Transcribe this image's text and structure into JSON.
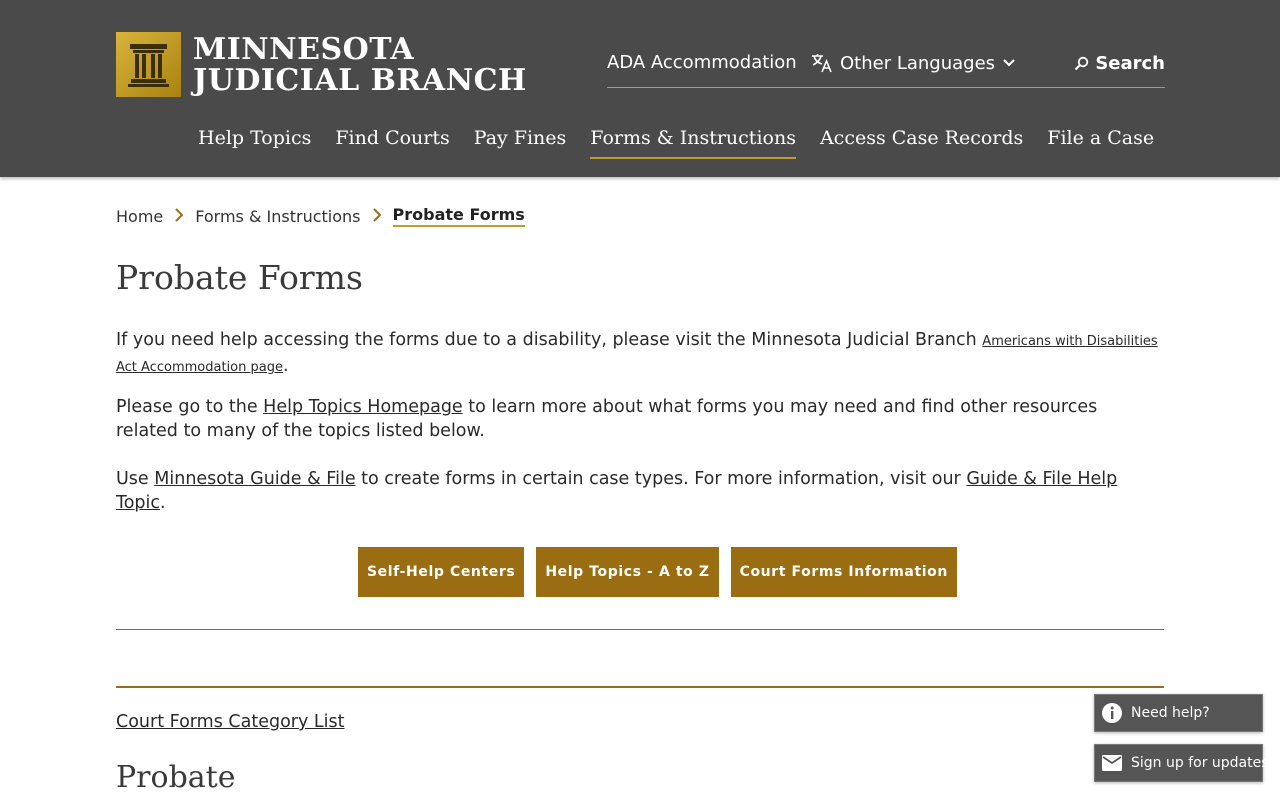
{
  "brand": {
    "line1": "MINNESOTA",
    "line2": "JUDICIAL BRANCH",
    "gold": "#c49a2c",
    "header_bg": "#4a4a4a"
  },
  "utility_nav": {
    "ada": "ADA Accommodation",
    "languages": "Other Languages",
    "search": "Search"
  },
  "main_nav": [
    {
      "label": "Help Topics",
      "active": false
    },
    {
      "label": "Find Courts",
      "active": false
    },
    {
      "label": "Pay Fines",
      "active": false
    },
    {
      "label": "Forms & Instructions",
      "active": true
    },
    {
      "label": "Access Case Records",
      "active": false
    },
    {
      "label": "File a Case",
      "active": false
    }
  ],
  "breadcrumb": [
    "Home",
    "Forms & Instructions",
    "Probate Forms"
  ],
  "page_title": "Probate Forms",
  "para1": {
    "text": "If you need help accessing the forms due to a disability, please visit the Minnesota Judicial Branch ",
    "link": "Americans with Disabilities Act Accommodation page",
    "end": "."
  },
  "para2": {
    "pre": "Please go to the ",
    "link": "Help Topics Homepage",
    "post": " to learn more about what forms you may need and find other resources related to many of the topics listed below."
  },
  "para3": {
    "pre": "Use ",
    "link1": "Minnesota Guide & File",
    "mid": " to create forms in certain case types. For more information, visit our ",
    "link2": "Guide & File Help Topic",
    "end": "."
  },
  "buttons": [
    "Self-Help Centers",
    "Help Topics - A to Z",
    "Court Forms Information"
  ],
  "category_link": "Court Forms Category List",
  "section_heading": "Probate",
  "floating": {
    "help": "Need help?",
    "updates": "Sign up for updates"
  }
}
